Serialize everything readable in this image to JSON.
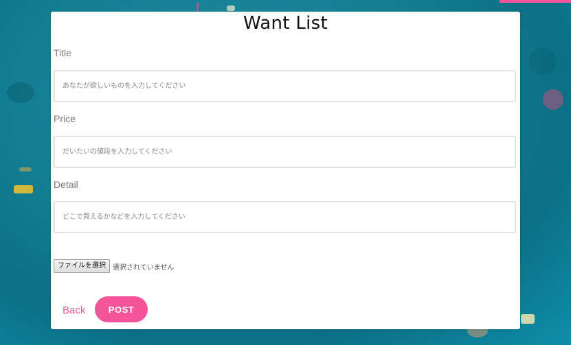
{
  "page": {
    "title": "Want List"
  },
  "form": {
    "title_label": "Title",
    "title_placeholder": "あなたが欲しいものを入力してください",
    "price_label": "Price",
    "price_placeholder": "だいたいの値段を入力してください",
    "detail_label": "Detail",
    "detail_placeholder": "どこで買えるかなどを入力してください",
    "file_button_label": "ファイルを選択",
    "file_status": "選択されていません"
  },
  "actions": {
    "back_label": "Back",
    "post_label": "POST"
  },
  "colors": {
    "accent": "#f4559a",
    "background": "#137d92",
    "back_link": "#e65a93"
  }
}
